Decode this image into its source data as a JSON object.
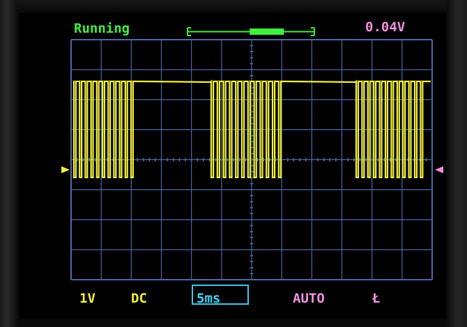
{
  "header": {
    "status_text": "Running",
    "trigger_level_text": "0.04V"
  },
  "footer": {
    "volts_per_div": "1V",
    "coupling": "DC",
    "timebase": "5ms",
    "trigger_mode": "AUTO",
    "trigger_edge_glyph": "Ł"
  },
  "display": {
    "grid_cols": 12,
    "grid_rows": 8,
    "grid_color": "#5068a8",
    "trace_color": "#f2f23a",
    "status_color": "#3ff03f",
    "accent_pink": "#f08fe0",
    "accent_cyan": "#38c8f0"
  },
  "position_indicator": {
    "window_fraction_start": 0.49,
    "window_fraction_end": 0.76
  }
}
